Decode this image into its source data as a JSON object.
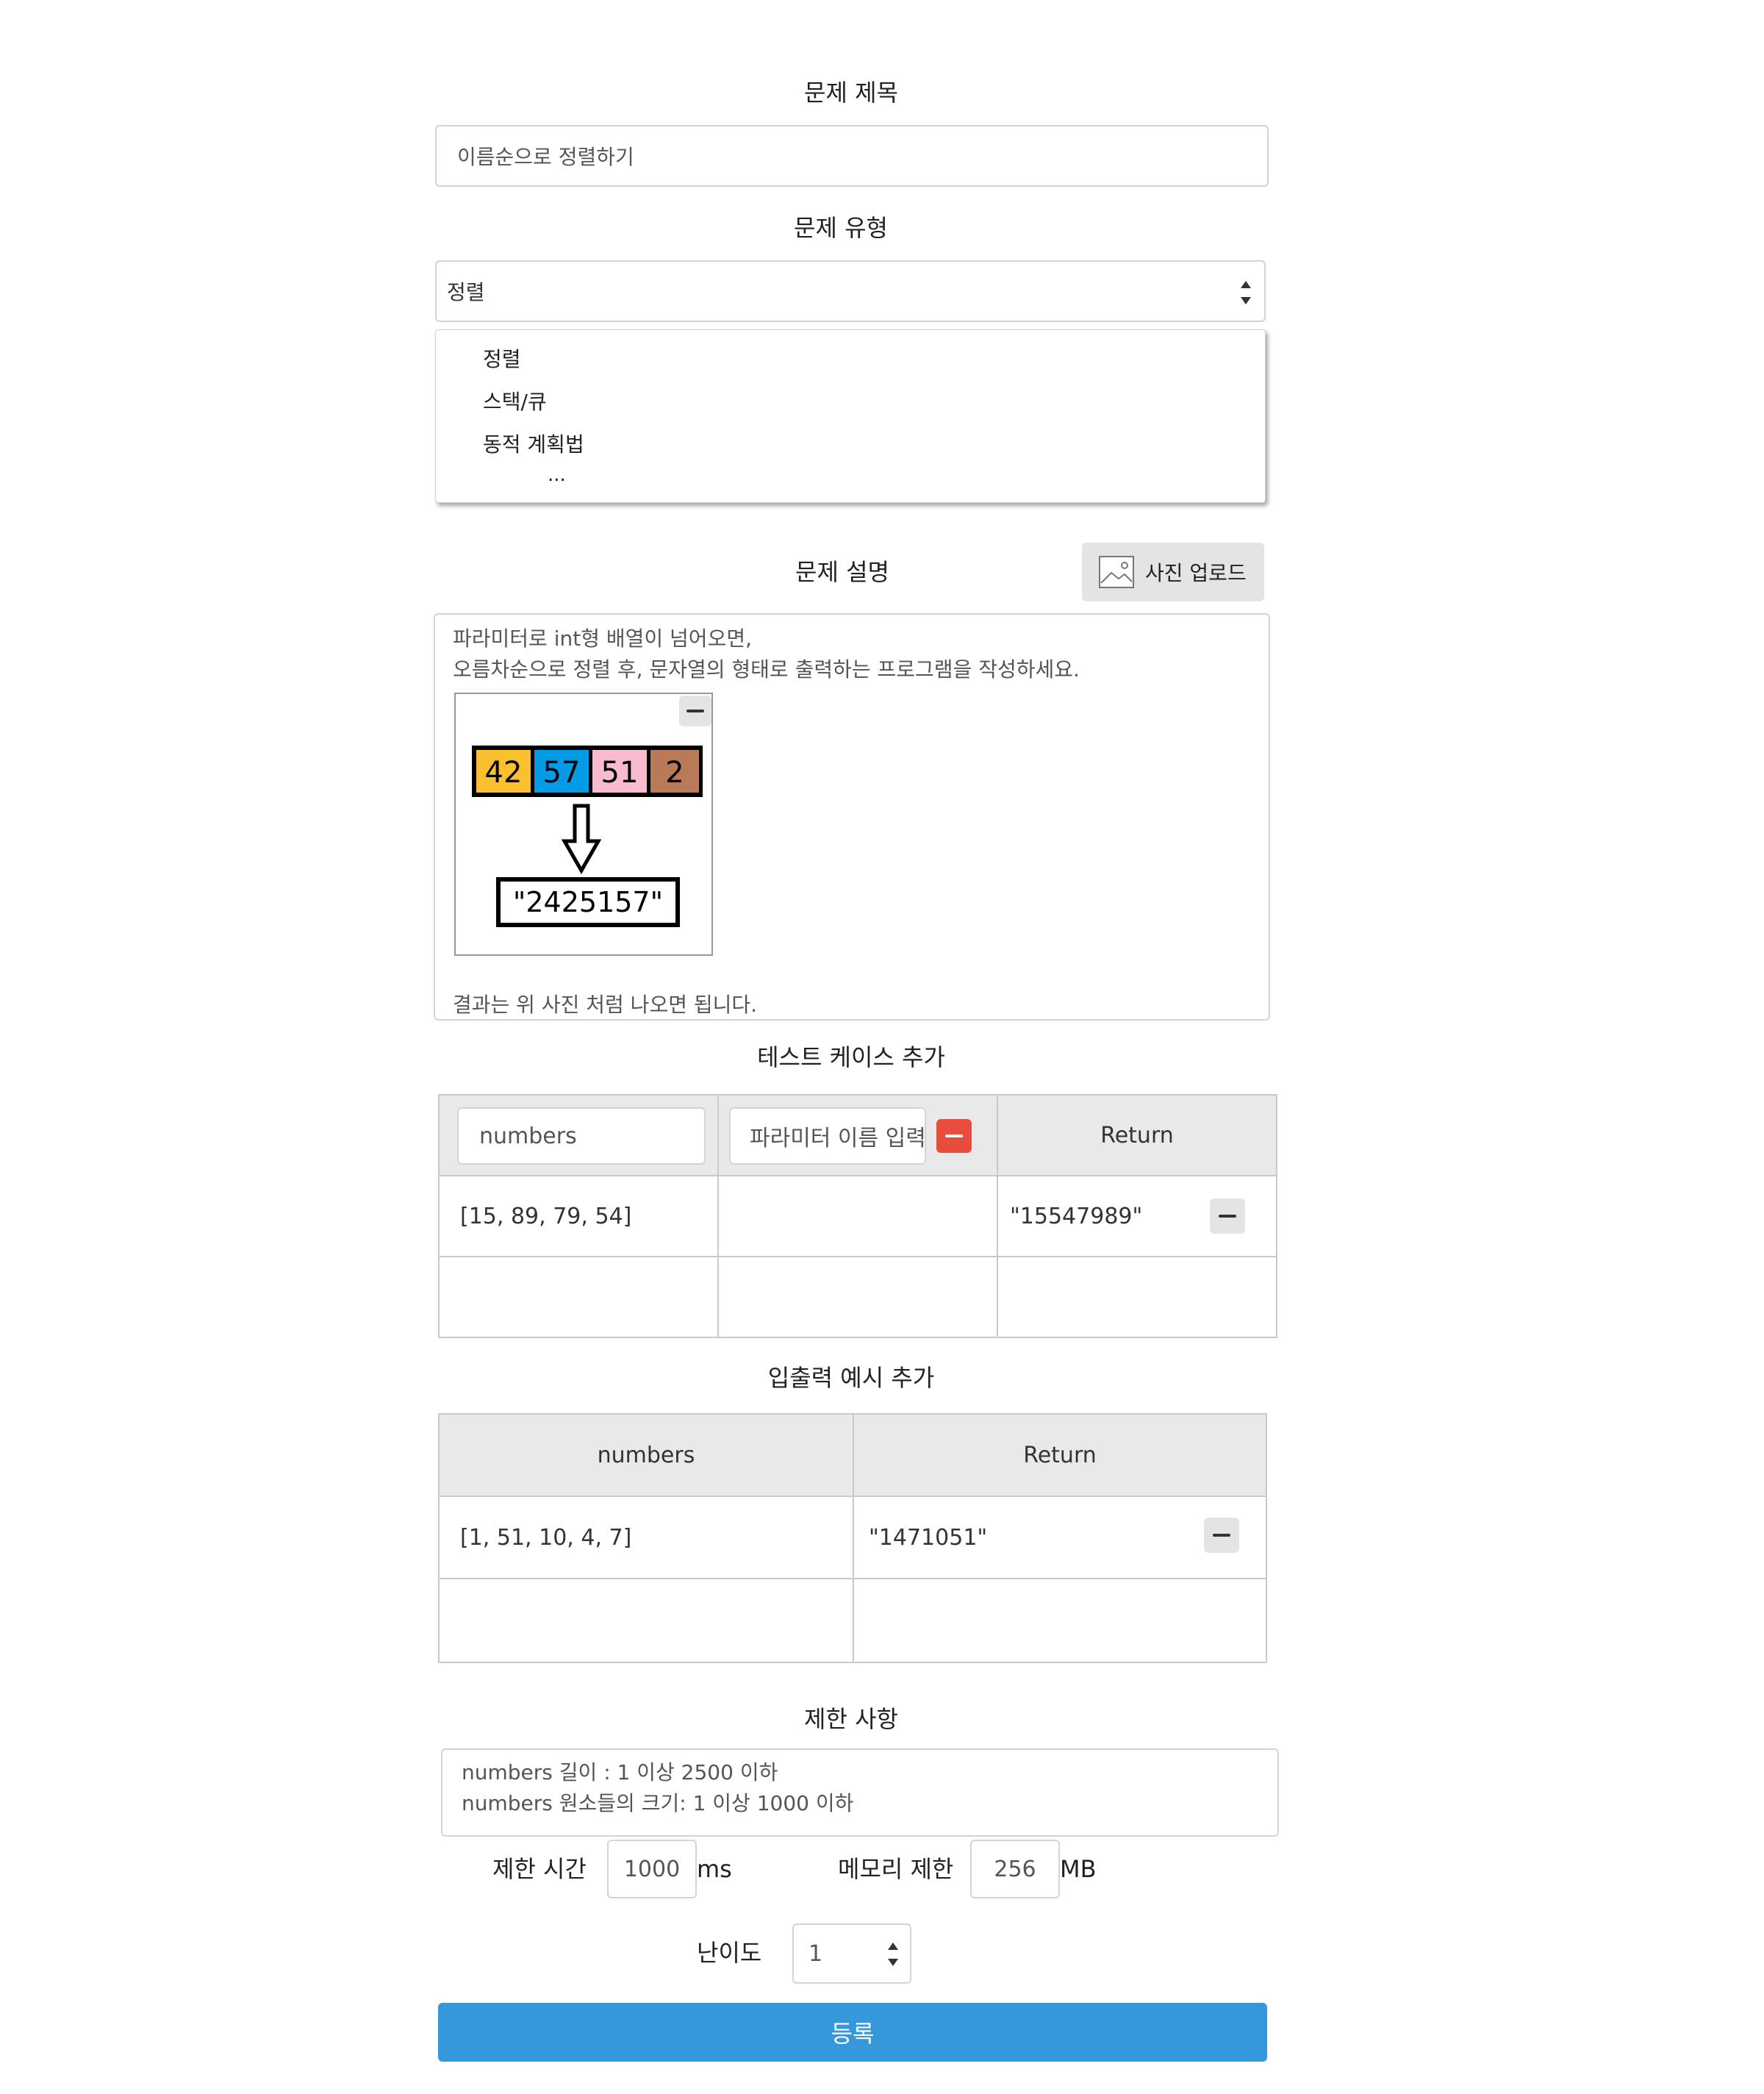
{
  "title_section": {
    "heading": "문제 제목",
    "value": "이름순으로 정렬하기"
  },
  "type_section": {
    "heading": "문제 유형",
    "selected": "정렬",
    "options": [
      "정렬",
      "스택/큐",
      "동적 계획법",
      "..."
    ]
  },
  "description_section": {
    "heading": "문제 설명",
    "upload_label": "사진 업로드",
    "line1": "파라미터로 int형 배열이 넘어오면,",
    "line2": "오름차순으로 정렬 후, 문자열의 형태로 출력하는 프로그램을 작성하세요.",
    "image": {
      "boxes": [
        {
          "value": "42",
          "color": "#fbc02d"
        },
        {
          "value": "57",
          "color": "#039be5"
        },
        {
          "value": "51",
          "color": "#f8bbd0"
        },
        {
          "value": "2",
          "color": "#b97a57"
        }
      ],
      "result": "\"2425157\""
    },
    "footer_line": "결과는 위 사진 처럼 나오면 됩니다."
  },
  "testcase_section": {
    "heading": "테스트 케이스 추가",
    "param1_value": "numbers",
    "param2_placeholder": "파라미터 이름 입력",
    "return_header": "Return",
    "rows": [
      {
        "input": "[15, 89, 79, 54]",
        "input2": "",
        "return": "\"15547989\""
      },
      {
        "input": "",
        "input2": "",
        "return": ""
      }
    ]
  },
  "example_section": {
    "heading": "입출력 예시 추가",
    "col1_header": "numbers",
    "col2_header": "Return",
    "rows": [
      {
        "input": "[1, 51, 10, 4, 7]",
        "return": "\"1471051\""
      },
      {
        "input": "",
        "return": ""
      }
    ]
  },
  "constraints_section": {
    "heading": "제한 사항",
    "line1": "numbers 길이 : 1 이상 2500 이하",
    "line2": "numbers 원소들의 크기: 1 이상 1000 이하",
    "time_label": "제한 시간",
    "time_value": "1000",
    "time_unit": "ms",
    "memory_label": "메모리 제한",
    "memory_value": "256",
    "memory_unit": "MB",
    "difficulty_label": "난이도",
    "difficulty_value": "1"
  },
  "submit_label": "등록",
  "colors": {
    "submit": "#3498db",
    "header_bg": "#e9e9e9",
    "remove_red": "#e74c3c"
  }
}
